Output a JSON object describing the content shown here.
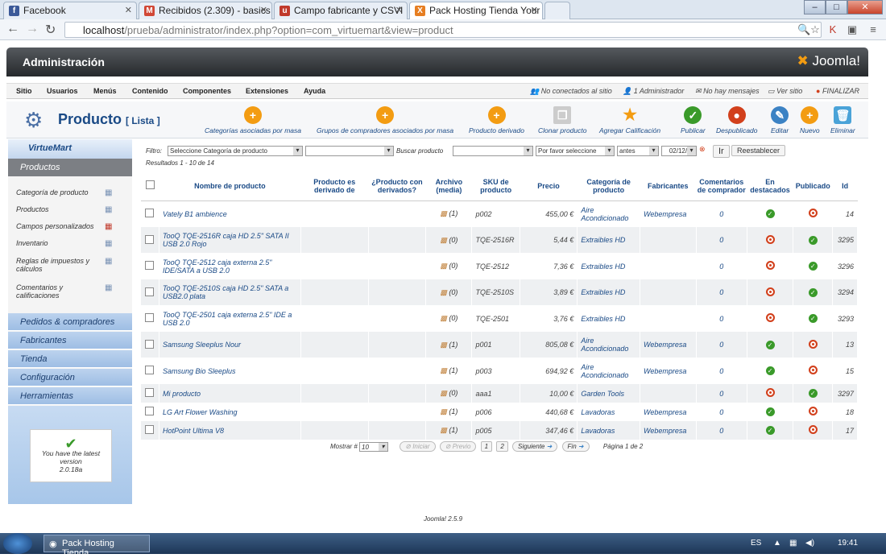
{
  "browser": {
    "tabs": [
      {
        "label": "Facebook",
        "icon": "f",
        "color": "#3b5998"
      },
      {
        "label": "Recibidos (2.309) - basics",
        "icon": "M",
        "color": "#d14836"
      },
      {
        "label": "Campo fabricante y CSVI",
        "icon": "u",
        "color": "#c0392b"
      },
      {
        "label": "Pack Hosting Tienda Your",
        "icon": "X",
        "color": "#e67e22"
      }
    ],
    "url_host": "localhost",
    "url_path": "/prueba/administrator/index.php?option=com_virtuemart&view=product"
  },
  "header": {
    "title": "Administración",
    "logo": "Joomla!"
  },
  "menu": {
    "items": [
      "Sitio",
      "Usuarios",
      "Menús",
      "Contenido",
      "Componentes",
      "Extensiones",
      "Ayuda"
    ],
    "status": [
      "No conectados al sitio",
      "1 Administrador",
      "No hay mensajes",
      "Ver sitio",
      "FINALIZAR"
    ]
  },
  "toolbar": {
    "title": "Producto",
    "subtitle": "[ Lista ]",
    "buttons": [
      "Categorías asociadas por masa",
      "Grupos de compradores asociados por masa",
      "Producto derivado",
      "Clonar producto",
      "Agregar Calificación",
      "Publicar",
      "Despublicado",
      "Editar",
      "Nuevo",
      "Eliminar"
    ]
  },
  "sidebar": {
    "brand": "VirtueMart",
    "active_section": "Productos",
    "links": [
      "Categoría de producto",
      "Productos",
      "Campos personalizados",
      "Inventario",
      "Reglas de impuestos y cálculos",
      "Comentarios y calificaciones"
    ],
    "sections": [
      "Pedidos & compradores",
      "Fabricantes",
      "Tienda",
      "Configuración",
      "Herramientas"
    ],
    "version_text": "You have the latest version",
    "version": "2.0.18a"
  },
  "filter": {
    "label": "Filtro:",
    "category_placeholder": "Seleccione Categoría de producto",
    "search_label": "Buscar producto",
    "order_select": "Por favor seleccione",
    "date_mode": "antes",
    "date": "02/12/13",
    "go": "Ir",
    "reset": "Reestablecer",
    "results": "Resultados 1 - 10 de 14"
  },
  "table": {
    "headers": [
      "Nombre de producto",
      "Producto es derivado de",
      "¿Producto con derivados?",
      "Archivo (media)",
      "SKU de producto",
      "Precio",
      "Categoría de producto",
      "Fabricantes",
      "Comentarios de comprador",
      "En destacados",
      "Publicado",
      "Id"
    ],
    "rows": [
      {
        "name": "Vately B1 ambience",
        "media": "(1)",
        "sku": "p002",
        "price": "455,00 €",
        "category": "Aire Acondicionado",
        "mfr": "Webempresa",
        "comments": "0",
        "featured": true,
        "published": false,
        "id": "14"
      },
      {
        "name": "TooQ TQE-2516R caja HD 2.5\" SATA II USB 2.0 Rojo",
        "media": "(0)",
        "sku": "TQE-2516R",
        "price": "5,44 €",
        "category": "Extraibles HD",
        "mfr": "",
        "comments": "0",
        "featured": false,
        "published": true,
        "id": "3295"
      },
      {
        "name": "TooQ TQE-2512 caja externa 2.5\" IDE/SATA a USB 2.0",
        "media": "(0)",
        "sku": "TQE-2512",
        "price": "7,36 €",
        "category": "Extraibles HD",
        "mfr": "",
        "comments": "0",
        "featured": false,
        "published": true,
        "id": "3296"
      },
      {
        "name": "TooQ TQE-2510S caja HD 2.5\" SATA a USB2.0 plata",
        "media": "(0)",
        "sku": "TQE-2510S",
        "price": "3,89 €",
        "category": "Extraibles HD",
        "mfr": "",
        "comments": "0",
        "featured": false,
        "published": true,
        "id": "3294"
      },
      {
        "name": "TooQ TQE-2501 caja externa 2.5\" IDE a USB 2.0",
        "media": "(0)",
        "sku": "TQE-2501",
        "price": "3,76 €",
        "category": "Extraibles HD",
        "mfr": "",
        "comments": "0",
        "featured": false,
        "published": true,
        "id": "3293"
      },
      {
        "name": "Samsung Sleeplus Nour",
        "media": "(1)",
        "sku": "p001",
        "price": "805,08 €",
        "category": "Aire Acondicionado",
        "mfr": "Webempresa",
        "comments": "0",
        "featured": true,
        "published": false,
        "id": "13"
      },
      {
        "name": "Samsung Bio Sleeplus",
        "media": "(1)",
        "sku": "p003",
        "price": "694,92 €",
        "category": "Aire Acondicionado",
        "mfr": "Webempresa",
        "comments": "0",
        "featured": true,
        "published": false,
        "id": "15"
      },
      {
        "name": "Mi producto",
        "media": "(0)",
        "sku": "aaa1",
        "price": "10,00 €",
        "category": "Garden Tools",
        "mfr": "",
        "comments": "0",
        "featured": false,
        "published": true,
        "id": "3297"
      },
      {
        "name": "LG Art Flower Washing",
        "media": "(1)",
        "sku": "p006",
        "price": "440,68 €",
        "category": "Lavadoras",
        "mfr": "Webempresa",
        "comments": "0",
        "featured": true,
        "published": false,
        "id": "18"
      },
      {
        "name": "HotPoint Ultima V8",
        "media": "(1)",
        "sku": "p005",
        "price": "347,46 €",
        "category": "Lavadoras",
        "mfr": "Webempresa",
        "comments": "0",
        "featured": true,
        "published": false,
        "id": "17"
      }
    ]
  },
  "pagination": {
    "show_label": "Mostrar #",
    "show_value": "10",
    "start": "Iniciar",
    "prev": "Previo",
    "pages": [
      "1",
      "2"
    ],
    "next": "Siguiente",
    "end": "Fin",
    "info": "Página 1 de 2"
  },
  "footer": "Joomla! 2.5.9",
  "taskbar": {
    "item": "Pack Hosting Tienda...",
    "lang": "ES",
    "time": "19:41"
  }
}
